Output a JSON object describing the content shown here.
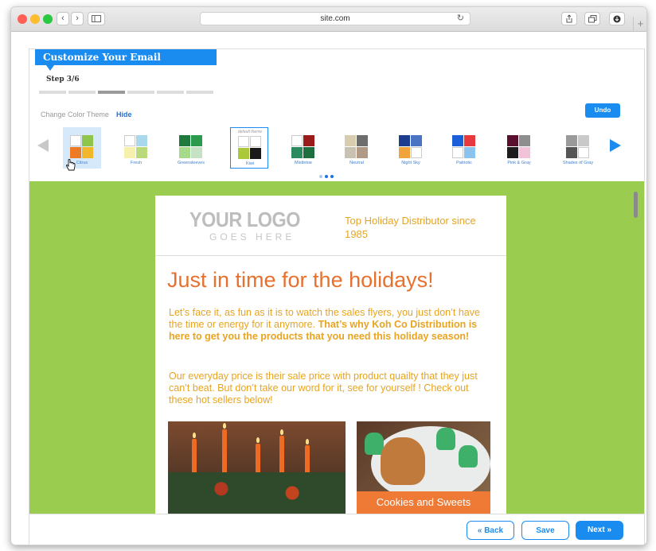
{
  "browser": {
    "url": "site.com",
    "traffic_colors": [
      "#ff5f57",
      "#febc2e",
      "#28c840"
    ],
    "nav_back": "‹",
    "nav_forward": "›",
    "reload": "↻",
    "new_tab": "+"
  },
  "wizard": {
    "title": "Customize Your Email",
    "step_label": "Step 3/6",
    "step_current": 3,
    "step_total": 6
  },
  "theme_picker": {
    "label": "Change Color Theme",
    "hide_label": "Hide",
    "undo_label": "Undo",
    "default_theme_note": "default theme",
    "themes": [
      {
        "name": "Citrus",
        "colors": [
          "#ffffff",
          "#8fc54a",
          "#ee7a25",
          "#f3b52a"
        ],
        "selected": true
      },
      {
        "name": "Fresh",
        "colors": [
          "#ffffff",
          "#a9d8ec",
          "#f6f0ad",
          "#b9d97a"
        ]
      },
      {
        "name": "Greensleeves",
        "colors": [
          "#1f7a3d",
          "#2c9a4d",
          "#a6d98a",
          "#c5e3c3"
        ]
      },
      {
        "name": "Kiwi",
        "colors": [
          "#ffffff",
          "#ffffff",
          "#aac83a",
          "#1a1a1a"
        ],
        "default": true
      },
      {
        "name": "Mistletoe",
        "colors": [
          "#ffffff",
          "#9b1b1b",
          "#2c8a5f",
          "#1f6e3e"
        ]
      },
      {
        "name": "Neutral",
        "colors": [
          "#d9cdb0",
          "#6d6d6d",
          "#c9c2b3",
          "#b09a86"
        ]
      },
      {
        "name": "Night Sky",
        "colors": [
          "#1d3d8f",
          "#4a73c4",
          "#f0a43a",
          "#ffffff"
        ]
      },
      {
        "name": "Patriotic",
        "colors": [
          "#1a5fd8",
          "#e8393e",
          "#ffffff",
          "#8ac4ee"
        ]
      },
      {
        "name": "Pink & Gray",
        "colors": [
          "#5b0f2f",
          "#8e8e8e",
          "#1c1c1c",
          "#f2c2d8"
        ]
      },
      {
        "name": "Shades of Gray",
        "colors": [
          "#9a9a9a",
          "#c9c9c9",
          "#555555",
          "#ffffff"
        ]
      }
    ]
  },
  "email": {
    "logo_main": "YOUR LOGO",
    "logo_sub": "GOES HERE",
    "tagline": "Top Holiday Distributor since 1985",
    "headline": "Just in time for the holidays!",
    "para1_plain": "Let’s face it, as fun as it is to watch the sales flyers, you just don’t have the time or energy for it anymore. ",
    "para1_bold": "That’s why Koh Co Distribution is here to get you the products that you need this holiday season!",
    "para2": "Our everyday price is their sale price with product quailty that they just can’t beat. But don’t take our word for it, see for yourself ! Check out these hot sellers below!",
    "product2_caption": "Cookies and Sweets",
    "bg_color": "#99cc4f",
    "accent_orange": "#e8702e",
    "accent_gold": "#e8a420"
  },
  "footer": {
    "back_label": "« Back",
    "save_label": "Save",
    "next_label": "Next »"
  }
}
